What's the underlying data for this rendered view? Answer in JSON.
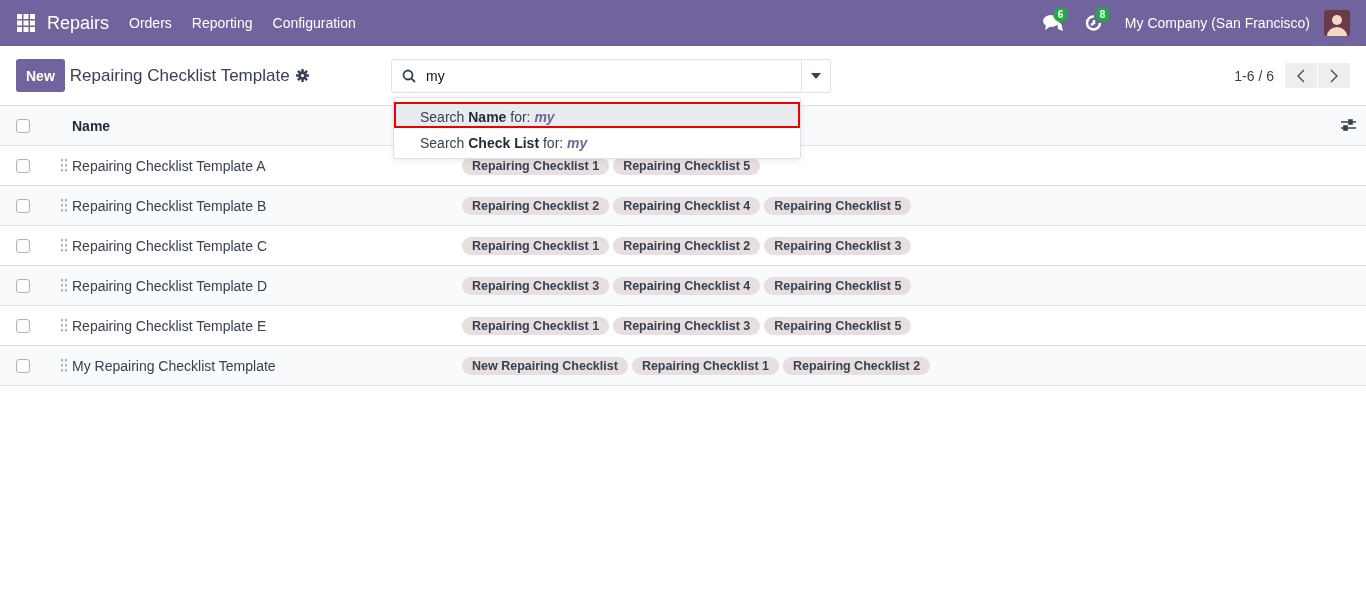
{
  "navbar": {
    "app": "Repairs",
    "menu": [
      "Orders",
      "Reporting",
      "Configuration"
    ],
    "messages_count": "6",
    "activities_count": "8",
    "company": "My Company (San Francisco)"
  },
  "control_panel": {
    "new_button": "New",
    "title": "Repairing Checklist Template",
    "search": {
      "value": "my"
    },
    "pager": "1-6 / 6"
  },
  "search_dropdown": [
    {
      "label": "Search **Name** for: *my*",
      "selected": true
    },
    {
      "label": "Search **Check List** for: *my*",
      "selected": false
    }
  ],
  "table": {
    "select_all_checked": false,
    "columns": [
      "Name"
    ],
    "rows": [
      {
        "checked": false,
        "name": "Repairing Checklist Template A",
        "tags": [
          "Repairing Checklist 1",
          "Repairing Checklist 5"
        ]
      },
      {
        "checked": false,
        "name": "Repairing Checklist Template B",
        "tags": [
          "Repairing Checklist 2",
          "Repairing Checklist 4",
          "Repairing Checklist 5"
        ]
      },
      {
        "checked": false,
        "name": "Repairing Checklist Template C",
        "tags": [
          "Repairing Checklist 1",
          "Repairing Checklist 2",
          "Repairing Checklist 3"
        ]
      },
      {
        "checked": false,
        "name": "Repairing Checklist Template D",
        "tags": [
          "Repairing Checklist 3",
          "Repairing Checklist 4",
          "Repairing Checklist 5"
        ]
      },
      {
        "checked": false,
        "name": "Repairing Checklist Template E",
        "tags": [
          "Repairing Checklist 1",
          "Repairing Checklist 3",
          "Repairing Checklist 5"
        ]
      },
      {
        "checked": false,
        "name": "My Repairing Checklist Template",
        "tags": [
          "New Repairing Checklist",
          "Repairing Checklist 1",
          "Repairing Checklist 2"
        ]
      }
    ]
  }
}
